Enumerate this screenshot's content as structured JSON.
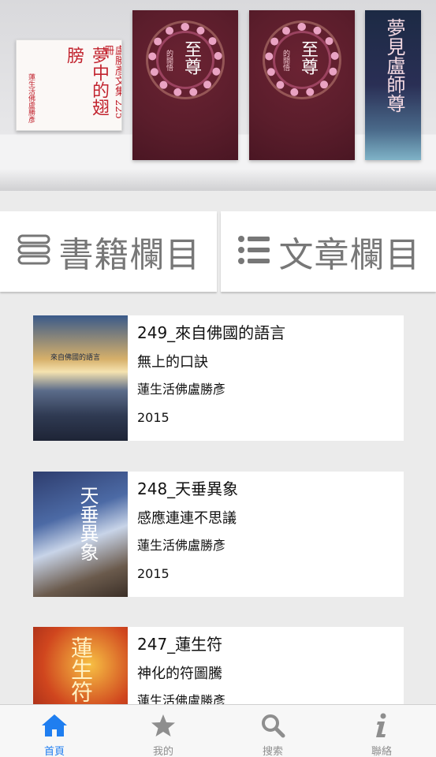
{
  "shelf": {
    "books": [
      {
        "name": "夢中的翅膀",
        "side_text": "盧勝彥文集 225冊",
        "seal": "蓮生活佛盧勝彥"
      },
      {
        "name": "至尊",
        "subtitle": "的開悟"
      },
      {
        "name": "至尊",
        "subtitle": "的開悟"
      },
      {
        "name": "夢見盧師尊"
      }
    ]
  },
  "tabs": {
    "books_label": "書籍欄目",
    "articles_label": "文章欄目"
  },
  "books": [
    {
      "title": "249_來自佛國的語言",
      "subtitle": "無上的口訣",
      "author": "蓮生活佛盧勝彥",
      "year": "2015",
      "cover_text": "來自佛國的語言"
    },
    {
      "title": "248_天垂異象",
      "subtitle": "感應連連不思議",
      "author": "蓮生活佛盧勝彥",
      "year": "2015",
      "cover_text": "天垂異象"
    },
    {
      "title": "247_蓮生符",
      "subtitle": "神化的符圖騰",
      "author": "蓮生活佛盧勝彥",
      "year": "",
      "cover_text": "蓮生符"
    }
  ],
  "tabbar": {
    "items": [
      {
        "label": "首頁",
        "icon": "home-icon",
        "active": true
      },
      {
        "label": "我的",
        "icon": "star-icon"
      },
      {
        "label": "搜索",
        "icon": "search-icon"
      },
      {
        "label": "聯絡",
        "icon": "info-icon"
      }
    ],
    "active_color": "#1f7ef0",
    "inactive_color": "#8e8e8e"
  }
}
